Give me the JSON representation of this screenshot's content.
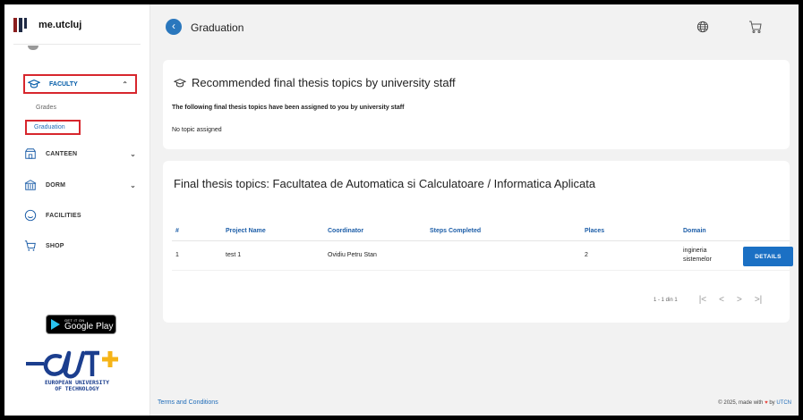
{
  "app": {
    "brand": "me.utcluj"
  },
  "header": {
    "title": "Graduation",
    "globe_icon": "globe-icon",
    "cart_icon": "cart-icon"
  },
  "sidebar": {
    "items": [
      {
        "label": "FACULTY",
        "icon": "graduation-cap-icon",
        "expanded": true
      },
      {
        "label": "CANTEEN",
        "icon": "canteen-icon"
      },
      {
        "label": "DORM",
        "icon": "building-icon"
      },
      {
        "label": "FACILITIES",
        "icon": "smile-icon"
      },
      {
        "label": "SHOP",
        "icon": "cart-icon"
      }
    ],
    "faculty_sub": [
      {
        "label": "Grades"
      },
      {
        "label": "Graduation",
        "active": true
      }
    ],
    "google_play": {
      "small": "GET IT ON",
      "big": "Google Play"
    },
    "eut": {
      "line1": "EUROPEAN UNIVERSITY",
      "line2": "OF TECHNOLOGY"
    }
  },
  "recommended": {
    "title": "Recommended final thesis topics by university staff",
    "subtitle": "The following final thesis topics have been assigned to you by university staff",
    "empty": "No topic assigned"
  },
  "topics": {
    "title": "Final thesis topics: Facultatea de Automatica si Calculatoare / Informatica Aplicata",
    "columns": {
      "num": "#",
      "name": "Project Name",
      "coord": "Coordinator",
      "steps": "Steps Completed",
      "places": "Places",
      "domain": "Domain"
    },
    "rows": [
      {
        "num": "1",
        "name": "test 1",
        "coord": "Ovidiu Petru Stan",
        "steps": "",
        "places": "2",
        "domain_line1": "ingineria",
        "domain_line2": "sistemelor",
        "action": "DETAILS"
      }
    ],
    "pagination": {
      "range": "1 - 1 din 1",
      "first": "|<",
      "prev": "<",
      "next": ">",
      "last": ">|"
    }
  },
  "footer": {
    "terms": "Terms and Conditions",
    "copy_prefix": "© 2025, made with",
    "copy_by": "by",
    "copy_org": "UTCN"
  },
  "colors": {
    "accent": "#1b70c4",
    "highlight": "#d7262d",
    "heart": "#e8473f"
  }
}
